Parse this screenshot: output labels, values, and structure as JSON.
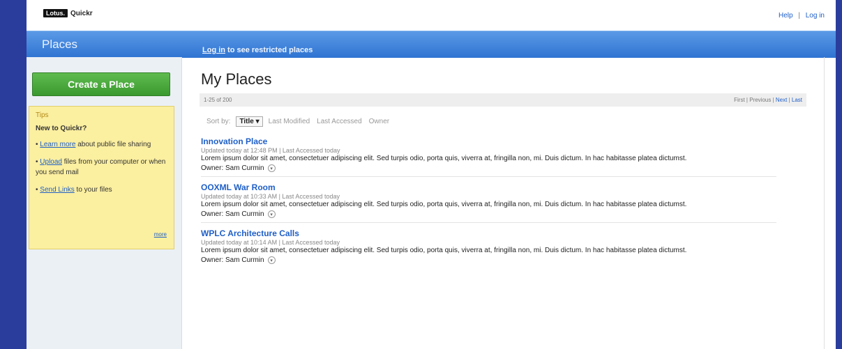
{
  "header": {
    "logo_lotus": "Lotus.",
    "logo_product": "Quickr",
    "help": "Help",
    "login": "Log in"
  },
  "banner": {
    "title": "Places",
    "login_link": "Log in",
    "restricted_text": " to see restricted places"
  },
  "sidebar": {
    "create_button": "Create a Place",
    "tips": {
      "heading": "Tips",
      "subheading": "New to Quickr?",
      "items": [
        {
          "link": "Learn more",
          "text": " about public file sharing"
        },
        {
          "link": "Upload",
          "text": " files from your computer or when you send mail"
        },
        {
          "link": "Send Links",
          "text": " to your files"
        }
      ],
      "more": "more"
    }
  },
  "main": {
    "title": "My Places",
    "count": "1-25 of 200",
    "nav": {
      "first": "First",
      "previous": "Previous",
      "next": "Next",
      "last": "Last"
    },
    "sort": {
      "label": "Sort by:",
      "selected": "Title",
      "options": [
        "Last Modified",
        "Last Accessed",
        "Owner"
      ]
    },
    "places": [
      {
        "name": "Innovation Place",
        "meta": "Updated today at 12:48 PM  | Last Accessed today",
        "desc": "Lorem ipsum dolor sit amet, consectetuer adipiscing elit. Sed turpis odio, porta quis, viverra at, fringilla non, mi. Duis dictum. In hac habitasse platea dictumst.",
        "owner": "Owner: Sam Curmin"
      },
      {
        "name": "OOXML War Room",
        "meta": "Updated today at 10:33 AM  | Last Accessed today",
        "desc": "Lorem ipsum dolor sit amet, consectetuer adipiscing elit. Sed turpis odio, porta quis, viverra at, fringilla non, mi. Duis dictum. In hac habitasse platea dictumst.",
        "owner": "Owner: Sam Curmin"
      },
      {
        "name": "WPLC Architecture Calls",
        "meta": "Updated today at 10:14 AM  | Last Accessed today",
        "desc": "Lorem ipsum dolor sit amet, consectetuer adipiscing elit. Sed turpis odio, porta quis, viverra at, fringilla non, mi. Duis dictum. In hac habitasse platea dictumst.",
        "owner": "Owner: Sam Curmin"
      }
    ]
  }
}
